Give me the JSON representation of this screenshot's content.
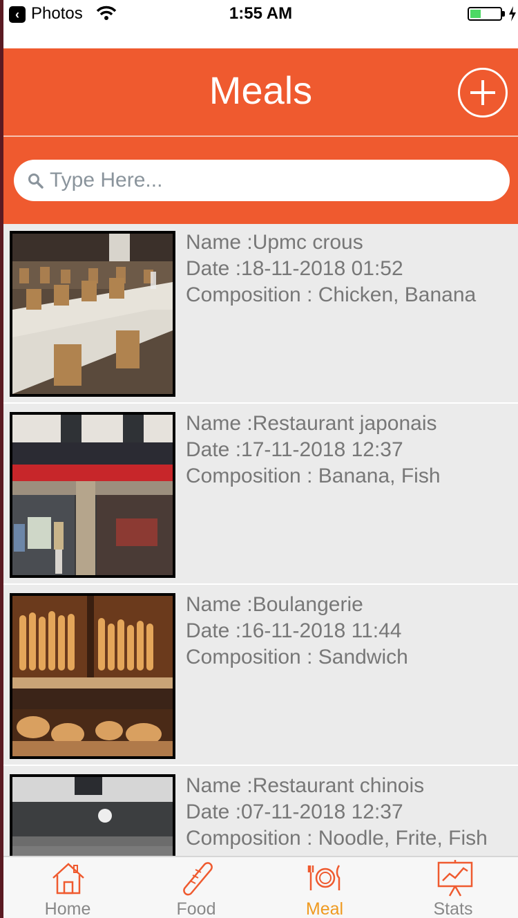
{
  "status_bar": {
    "back_app": "Photos",
    "time": "1:55 AM",
    "battery_level": 0.35
  },
  "header": {
    "title": "Meals",
    "add_icon": "plus-circle-icon"
  },
  "search": {
    "placeholder": "Type Here...",
    "value": ""
  },
  "meals": [
    {
      "name": "Name :Upmc crous",
      "date": "Date :18-11-2018  01:52",
      "composition": "Composition : Chicken, Banana",
      "image": "cafeteria-photo"
    },
    {
      "name": "Name :Restaurant japonais",
      "date": "Date :17-11-2018  12:37",
      "composition": "Composition : Banana, Fish",
      "image": "restaurant-storefront-photo"
    },
    {
      "name": "Name :Boulangerie",
      "date": "Date :16-11-2018  11:44",
      "composition": "Composition : Sandwich",
      "image": "bakery-photo"
    },
    {
      "name": "Name :Restaurant chinois",
      "date": "Date :07-11-2018  12:37",
      "composition": "Composition : Noodle, Frite, Fish",
      "image": "chinese-restaurant-photo"
    }
  ],
  "tabs": [
    {
      "label": "Home",
      "icon": "home-icon",
      "active": false
    },
    {
      "label": "Food",
      "icon": "baguette-icon",
      "active": false
    },
    {
      "label": "Meal",
      "icon": "plate-cutlery-icon",
      "active": true
    },
    {
      "label": "Stats",
      "icon": "chart-board-icon",
      "active": false
    }
  ],
  "colors": {
    "accent": "#ef5a2f",
    "active_tab": "#ef9a20",
    "list_bg": "#ebebeb",
    "meta_text": "#777777"
  }
}
